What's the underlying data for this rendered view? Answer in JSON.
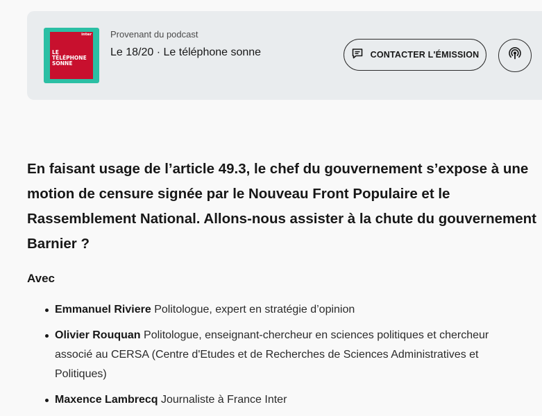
{
  "podcast": {
    "label": "Provenant du podcast",
    "title": "Le 18/20 · Le téléphone sonne",
    "cover_text": "LE\nTÉLÉPHONE\nSONNE",
    "cover_brand": "inter",
    "contact_label": "CONTACTER L'ÉMISSION",
    "contact_icon": "message-icon",
    "podcast_icon": "podcast-icon",
    "colors": {
      "card_bg": "#e9ecee",
      "cover_teal": "#2bbfa4",
      "cover_red": "#c8102e"
    }
  },
  "article": {
    "intro": "En faisant usage de l’article 49.3, le chef du gouvernement s’expose à une motion de censure signée par le Nouveau Front Populaire et le Rassemblement National. Allons-nous assister à la chute du gouvernement Barnier ?",
    "guests_heading": "Avec",
    "guests": [
      {
        "name": "Emmanuel Riviere",
        "description": "Politologue, expert en stratégie d’opinion"
      },
      {
        "name": "Olivier Rouquan",
        "description": "Politologue, enseignant-chercheur en sciences politiques et chercheur associé au CERSA (Centre d'Etudes et de Recherches de Sciences Administratives et Politiques)"
      },
      {
        "name": "Maxence Lambrecq",
        "description": "Journaliste à France Inter"
      }
    ]
  }
}
